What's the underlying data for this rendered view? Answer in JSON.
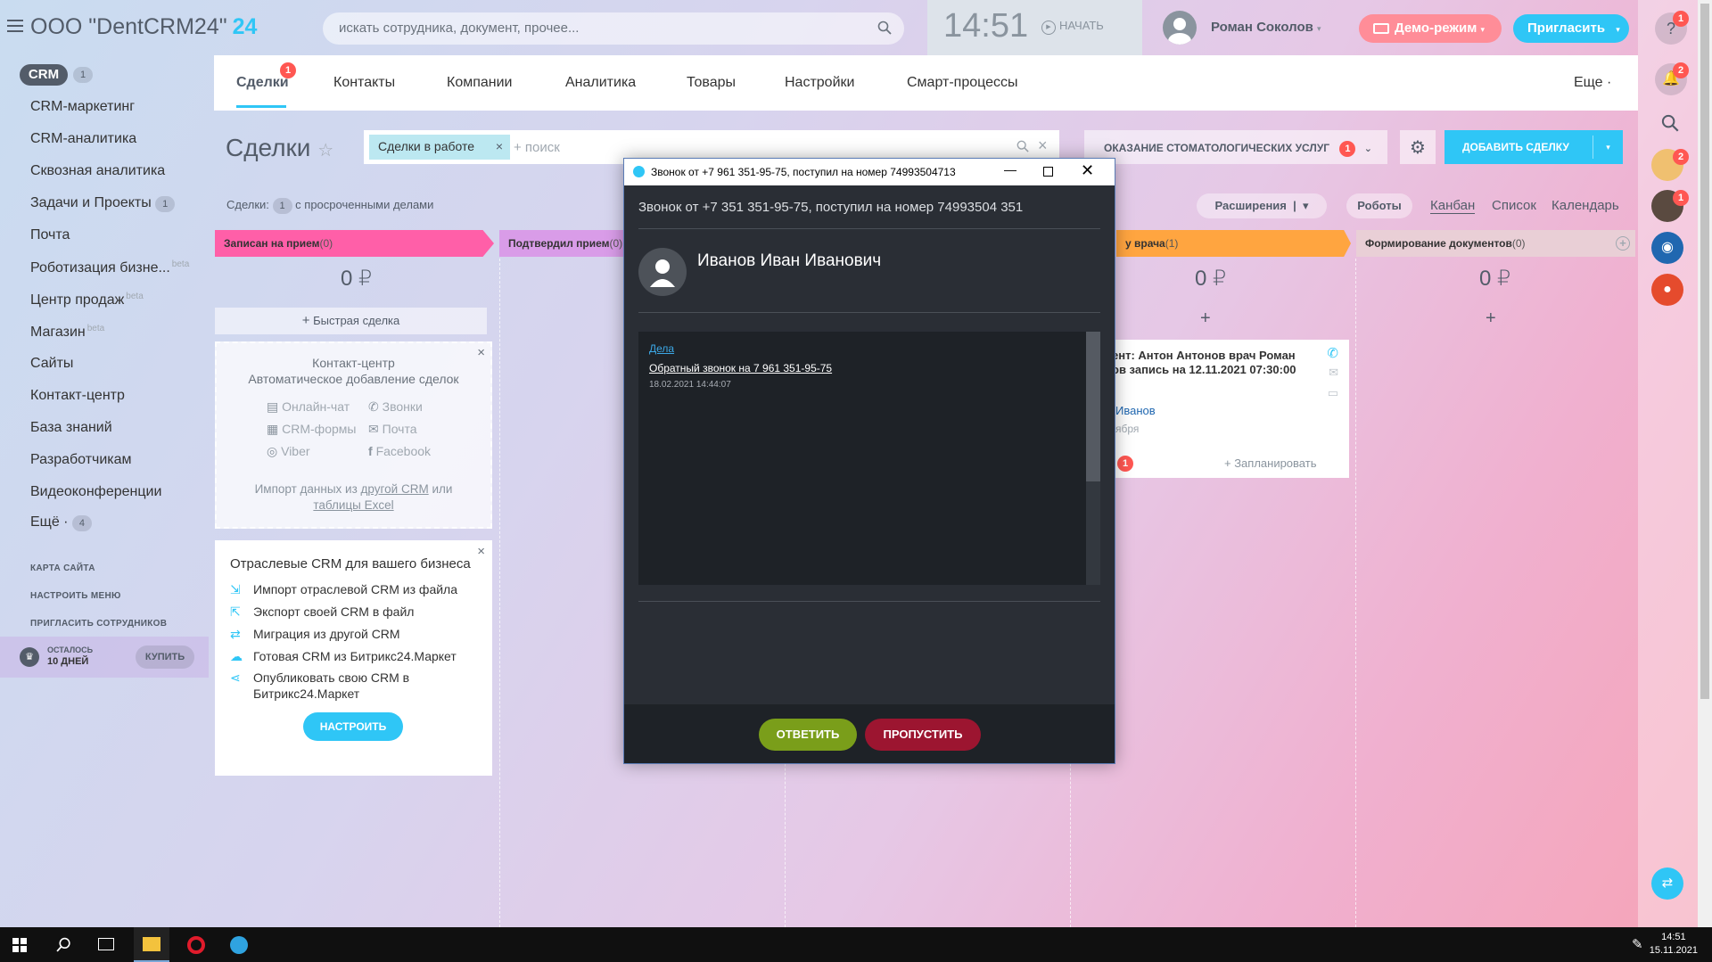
{
  "header": {
    "company": "ООО \"DentCRM24\"",
    "brand_suffix": "24",
    "search_placeholder": "искать сотрудника, документ, прочее...",
    "clock": "14:51",
    "start_label": "НАЧАТЬ",
    "user_name": "Роман Соколов",
    "demo_label": "Демо-режим",
    "invite_label": "Пригласить"
  },
  "sidebar": {
    "crm_label": "CRM",
    "crm_count": "1",
    "items": [
      {
        "label": "CRM-маркетинг"
      },
      {
        "label": "CRM-аналитика"
      },
      {
        "label": "Сквозная аналитика"
      },
      {
        "label": "Задачи и Проекты",
        "count": "1"
      },
      {
        "label": "Почта"
      },
      {
        "label": "Роботизация бизне...",
        "beta": "beta"
      },
      {
        "label": "Центр продаж",
        "beta": "beta"
      },
      {
        "label": "Магазин",
        "beta": "beta"
      },
      {
        "label": "Сайты"
      },
      {
        "label": "Контакт-центр"
      },
      {
        "label": "База знаний"
      },
      {
        "label": "Разработчикам"
      },
      {
        "label": "Видеоконференции"
      },
      {
        "label": "Ещё ·",
        "count": "4"
      }
    ],
    "links": [
      "КАРТА САЙТА",
      "НАСТРОИТЬ МЕНЮ",
      "ПРИГЛАСИТЬ СОТРУДНИКОВ"
    ],
    "trial_line1": "ОСТАЛОСЬ",
    "trial_line2": "10 ДНЕЙ",
    "buy_label": "КУПИТЬ"
  },
  "tabs": [
    {
      "label": "Сделки",
      "badge": "1",
      "active": true
    },
    {
      "label": "Контакты"
    },
    {
      "label": "Компании"
    },
    {
      "label": "Аналитика"
    },
    {
      "label": "Товары"
    },
    {
      "label": "Настройки"
    },
    {
      "label": "Смарт-процессы"
    },
    {
      "label": "Еще ·"
    }
  ],
  "toolbar": {
    "title": "Сделки",
    "filter_chip": "Сделки в работе",
    "search_placeholder": "+ поиск",
    "pipeline": "ОКАЗАНИЕ СТОМАТОЛОГИЧЕСКИХ УСЛУГ",
    "pipeline_badge": "1",
    "add_deal": "ДОБАВИТЬ СДЕЛКУ"
  },
  "statline": {
    "prefix": "Сделки:",
    "count": "1",
    "suffix": "с просроченными делами"
  },
  "views": {
    "extensions": "Расширения",
    "robots": "Роботы",
    "kanban": "Канбан",
    "list": "Список",
    "calendar": "Календарь"
  },
  "kanban": {
    "columns": [
      {
        "title": "Записан на прием",
        "count": "(0)",
        "sum": "0 ₽",
        "color": "#ff5fa8"
      },
      {
        "title": "Подтвердил прием",
        "count": "(0)",
        "color": "#d99ce8"
      },
      {
        "title": "у врача",
        "count": "(1)",
        "sum": "0 ₽",
        "color": "#ffa540"
      },
      {
        "title": "Формирование документов",
        "count": "(0)",
        "sum": "0 ₽",
        "color": "#e9cfd6"
      }
    ],
    "quick_deal": "Быстрая сделка",
    "deal_card": {
      "title_line1": "ент: Антон Антонов врач Роман",
      "title_line2": "ов запись на 12.11.2021 07:30:00",
      "client": "Иванов",
      "date": "ября",
      "badge": "1",
      "plan": "+ Запланировать"
    }
  },
  "contact_center": {
    "title": "Контакт-центр",
    "subtitle": "Автоматическое добавление сделок",
    "items": [
      "Онлайн-чат",
      "Звонки",
      "CRM-формы",
      "Почта",
      "Viber",
      "Facebook"
    ],
    "import_prefix": "Импорт данных из",
    "import_link1": "другой CRM",
    "import_mid": "или",
    "import_link2": "таблицы Excel"
  },
  "industry_crm": {
    "title": "Отраслевые CRM для вашего бизнеса",
    "items": [
      "Импорт отраслевой CRM из файла",
      "Экспорт своей CRM в файл",
      "Миграция из другой CRM",
      "Готовая CRM из Битрикс24.Маркет",
      "Опубликовать свою CRM в",
      "Битрикс24.Маркет"
    ],
    "button": "НАСТРОИТЬ"
  },
  "call_popup": {
    "window_title": "Звонок от +7 961 351-95-75, поступил на номер 74993504713",
    "subtitle": "Звонок от +7 351 351-95-75, поступил на номер 74993504 351",
    "caller": "Иванов Иван Иванович",
    "section_link": "Дела",
    "event": "Обратный звонок на 7 961 351-95-75",
    "event_date": "18.02.2021 14:44:07",
    "answer": "ОТВЕТИТЬ",
    "skip": "ПРОПУСТИТЬ"
  },
  "right_panel": {
    "help_badge": "1",
    "notif_badge": "2",
    "avatar1_badge": "2",
    "avatar2_badge": "1"
  },
  "taskbar": {
    "time": "14:51",
    "date": "15.11.2021"
  }
}
